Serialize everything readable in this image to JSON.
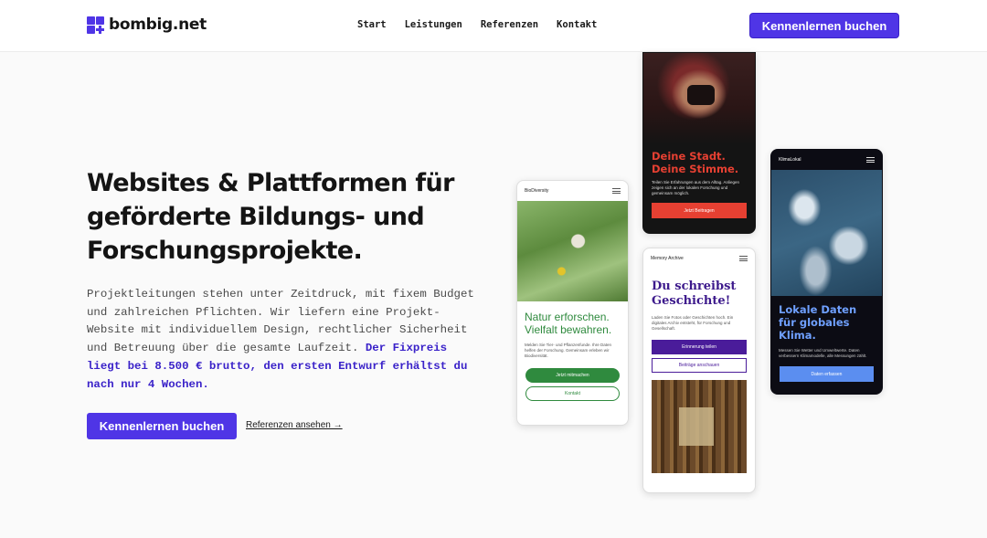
{
  "header": {
    "logo_text": "bombig.net",
    "nav": [
      "Start",
      "Leistungen",
      "Referenzen",
      "Kontakt"
    ],
    "cta": "Kennenlernen buchen"
  },
  "hero": {
    "title": "Websites & Plattformen für geförderte Bildungs- und Forschungsprojekte.",
    "text": "Projektleitungen stehen unter Zeitdruck, mit fixem Budget und zahlreichen Pflichten. Wir liefern eine Projekt-Website mit individuellem Design, rechtlicher Sicherheit und Betreuung über die gesamte Laufzeit.",
    "highlight": "Der Fixpreis liegt bei 8.500 € brutto, den ersten Entwurf erhältst du nach nur 4 Wochen.",
    "cta": "Kennenlernen buchen",
    "link": "Referenzen ansehen →"
  },
  "mockups": {
    "biodiversity": {
      "brand": "BioDiversity",
      "heading": "Natur erforschen. Vielfalt bewahren.",
      "text": "Melden Sie Tier- und Pflanzenfunde. Ihre Daten helfen der Forschung. Gemeinsam erleben wir Biodiversität.",
      "button_primary": "Jetzt mitmachen",
      "button_secondary": "Kontakt"
    },
    "city": {
      "heading": "Deine Stadt. Deine Stimme.",
      "text": "Teilen Sie Erfahrungen aus dem Alltag. Anliegen zeigen sich an der lokalen Forschung und gemeinsam möglich.",
      "button": "Jetzt Beitragen"
    },
    "archive": {
      "brand": "Memory Archive",
      "heading": "Du schreibst Geschichte!",
      "text": "Laden Sie Fotos oder Geschichten hoch. Ein digitales Archiv entsteht, für Forschung und Gesellschaft.",
      "button_primary": "Erinnerung teilen",
      "button_secondary": "Beiträge anschauen"
    },
    "climate": {
      "brand": "KlimaLokal",
      "heading": "Lokale Daten für globales Klima.",
      "text": "Messen Sie Wetter und Umweltwerte. Daten verbessern Klimamodelle, alle Messungen zählt.",
      "button": "Daten erfassen"
    }
  },
  "colors": {
    "accent": "#4f35e6",
    "bio_green": "#2f8a3e",
    "city_red": "#e64032",
    "archive_purple": "#4a1c9a",
    "climate_blue": "#5b8ef0"
  }
}
